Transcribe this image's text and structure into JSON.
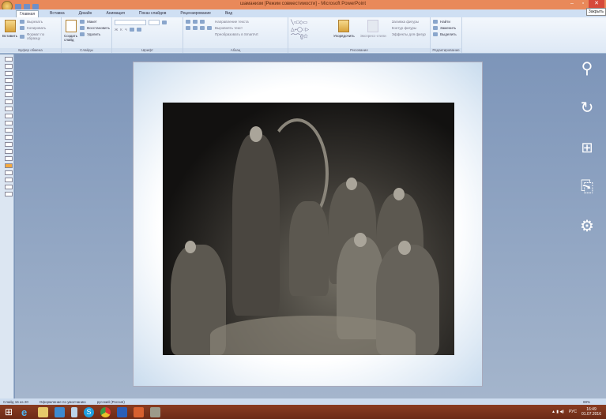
{
  "window": {
    "title": "шаманизм [Режим совместимости] - Microsoft PowerPoint",
    "tooltip": "Закрыть",
    "min": "–",
    "max": "▫",
    "close": "✕"
  },
  "tabs": [
    "Главная",
    "Вставка",
    "Дизайн",
    "Анимация",
    "Показ слайдов",
    "Рецензирование",
    "Вид"
  ],
  "ribbon": {
    "clipboard": {
      "paste": "Вставить",
      "cut": "Вырезать",
      "copy": "Копировать",
      "format": "Формат по образцу",
      "label": "Буфер обмена"
    },
    "slides": {
      "new": "Создать слайд",
      "layout": "Макет",
      "reset": "Восстановить",
      "delete": "Удалить",
      "label": "Слайды"
    },
    "font": {
      "label": "Шрифт",
      "bold": "Ж",
      "italic": "К",
      "underline": "Ч"
    },
    "paragraph": {
      "direction": "Направление текста",
      "align": "Выровнять текст",
      "smartart": "Преобразовать в SmartArt",
      "label": "Абзац"
    },
    "drawing": {
      "arrange": "Упорядочить",
      "styles": "Экспресс-стили",
      "fill": "Заливка фигуры",
      "outline": "Контур фигуры",
      "effects": "Эффекты для фигур",
      "label": "Рисование"
    },
    "editing": {
      "find": "Найти",
      "replace": "Заменить",
      "select": "Выделить",
      "label": "Редактирование"
    }
  },
  "status": {
    "slide": "Слайд 16 из 20",
    "theme": "Оформление по умолчанию",
    "lang": "русский (Россия)",
    "zoom": "69%"
  },
  "taskbar": {
    "lang": "РУС",
    "time": "16:49",
    "date": "01.07.2016"
  },
  "charms": [
    "search-icon",
    "share-icon",
    "start-icon",
    "devices-icon",
    "settings-icon"
  ]
}
